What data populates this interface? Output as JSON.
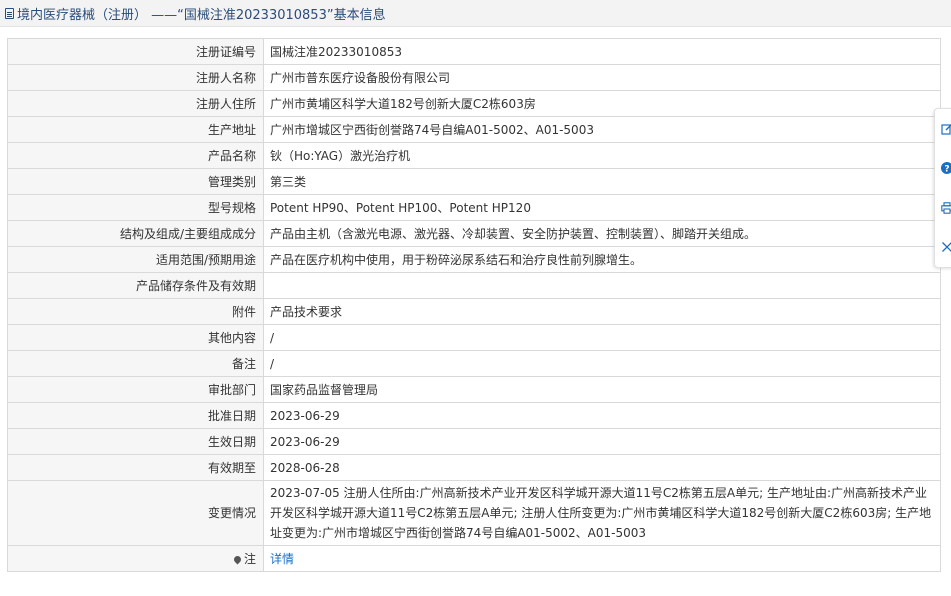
{
  "header": {
    "title": "境内医疗器械（注册） ——“国械注准20233010853”基本信息"
  },
  "rows": [
    {
      "label": "注册证编号",
      "value": "国械注准20233010853"
    },
    {
      "label": "注册人名称",
      "value": "广州市普东医疗设备股份有限公司"
    },
    {
      "label": "注册人住所",
      "value": "广州市黄埔区科学大道182号创新大厦C2栋603房"
    },
    {
      "label": "生产地址",
      "value": "广州市增城区宁西街创誉路74号自编A01-5002、A01-5003"
    },
    {
      "label": "产品名称",
      "value": "钬（Ho:YAG）激光治疗机"
    },
    {
      "label": "管理类别",
      "value": "第三类"
    },
    {
      "label": "型号规格",
      "value": "Potent HP90、Potent HP100、Potent HP120"
    },
    {
      "label": "结构及组成/主要组成成分",
      "value": "产品由主机（含激光电源、激光器、冷却装置、安全防护装置、控制装置）、脚踏开关组成。"
    },
    {
      "label": "适用范围/预期用途",
      "value": "产品在医疗机构中使用，用于粉碎泌尿系结石和治疗良性前列腺增生。"
    },
    {
      "label": "产品储存条件及有效期",
      "value": ""
    },
    {
      "label": "附件",
      "value": "产品技术要求"
    },
    {
      "label": "其他内容",
      "value": "/"
    },
    {
      "label": "备注",
      "value": "/"
    },
    {
      "label": "审批部门",
      "value": "国家药品监督管理局"
    },
    {
      "label": "批准日期",
      "value": "2023-06-29"
    },
    {
      "label": "生效日期",
      "value": "2023-06-29"
    },
    {
      "label": "有效期至",
      "value": "2028-06-28"
    },
    {
      "label": "变更情况",
      "value": "2023-07-05 注册人住所由:广州高新技术产业开发区科学城开源大道11号C2栋第五层A单元; 生产地址由:广州高新技术产业开发区科学城开源大道11号C2栋第五层A单元; 注册人住所变更为:广州市黄埔区科学大道182号创新大厦C2栋603房; 生产地址变更为:广州市增城区宁西街创誉路74号自编A01-5002、A01-5003"
    }
  ],
  "note_row": {
    "label": "注",
    "link": "详情",
    "icon": "map-pin-icon"
  },
  "side_toolbar": {
    "icons": [
      "edit-icon",
      "help-icon",
      "print-icon",
      "close-icon"
    ]
  },
  "colors": {
    "header_text": "#2b4d7a",
    "label_bg": "#f6f6f6",
    "border": "#d9d9d9",
    "link": "#1a6fc4",
    "toolbar_icon": "#1a6fc4"
  }
}
